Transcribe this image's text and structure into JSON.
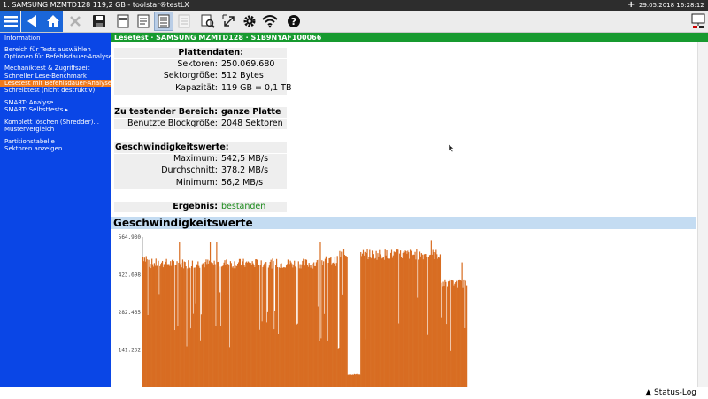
{
  "titlebar": {
    "title": "1: SAMSUNG MZMTD128  119,2 GB - toolstar®testLX",
    "datetime": "29.05.2018 16:28:12"
  },
  "toolbar": {
    "icons": [
      "menu-icon",
      "back-icon",
      "home-icon",
      "close-icon",
      "save-icon",
      "document-icon",
      "document-lines-icon",
      "report-icon",
      "disabled-report-icon",
      "search-report-icon",
      "resize-icon",
      "gear-icon",
      "wifi-icon",
      "help-icon",
      "network-icon"
    ]
  },
  "sidebar": {
    "items": [
      {
        "label": "Information"
      },
      {
        "label": "Bereich für Tests auswählen"
      },
      {
        "label": "Optionen für Befehlsdauer-Analyse"
      },
      {
        "label": "Mechaniktest & Zugriffszeit"
      },
      {
        "label": "Schneller Lese-Benchmark"
      },
      {
        "label": "Lesetest mit Befehlsdauer-Analyse"
      },
      {
        "label": "Schreibtest (nicht destruktiv)"
      },
      {
        "label": "SMART: Analyse"
      },
      {
        "label": "SMART: Selbsttests  ▸"
      },
      {
        "label": "Komplett löschen (Shredder)..."
      },
      {
        "label": "Mustervergleich"
      },
      {
        "label": "Partitionstabelle"
      },
      {
        "label": "Sektoren anzeigen"
      }
    ]
  },
  "header": {
    "text": "Lesetest · SAMSUNG MZMTD128 · S1B9NYAF100066"
  },
  "disk": {
    "heading": "Plattendaten:",
    "sectors_label": "Sektoren:",
    "sectors_value": "250.069.680",
    "sector_size_label": "Sektorgröße:",
    "sector_size_value": "512 Bytes",
    "capacity_label": "Kapazität:",
    "capacity_value": "119 GB = 0,1 TB"
  },
  "range": {
    "label": "Zu testender Bereich:",
    "value": "ganze Platte",
    "block_label": "Benutzte Blockgröße:",
    "block_value": "2048 Sektoren"
  },
  "speeds": {
    "heading": "Geschwindigkeitswerte:",
    "max_label": "Maximum:",
    "max_value": "542,5 MB/s",
    "avg_label": "Durchschnitt:",
    "avg_value": "378,2 MB/s",
    "min_label": "Minimum:",
    "min_value": "56,2 MB/s"
  },
  "result": {
    "label": "Ergebnis:",
    "value": "bestanden"
  },
  "chart_section_title": "Geschwindigkeitswerte",
  "status_button": "▲ Status-Log",
  "colors": {
    "sidebar": "#0a46e6",
    "selected": "#f07a1c",
    "header": "#179a2f",
    "chart_bar": "#d86d22",
    "result_ok": "#1a8a1a"
  },
  "chart_data": {
    "type": "area",
    "title": "",
    "yticks": [
      "564.930",
      "423.698",
      "282.465",
      "141.232"
    ],
    "ylim": [
      0,
      564.93
    ],
    "x_range": [
      0,
      1
    ],
    "segments": [
      {
        "x": [
          0.0,
          0.02
        ],
        "level": 500
      },
      {
        "x": [
          0.02,
          0.55
        ],
        "level": 475
      },
      {
        "x": [
          0.55,
          0.6
        ],
        "level": 485
      },
      {
        "x": [
          0.6,
          0.605
        ],
        "level": 150
      },
      {
        "x": [
          0.605,
          0.63
        ],
        "level": 510
      },
      {
        "x": [
          0.63,
          0.67
        ],
        "level": 50
      },
      {
        "x": [
          0.67,
          0.92
        ],
        "level": 510
      },
      {
        "x": [
          0.92,
          1.0
        ],
        "level": 400
      }
    ]
  }
}
